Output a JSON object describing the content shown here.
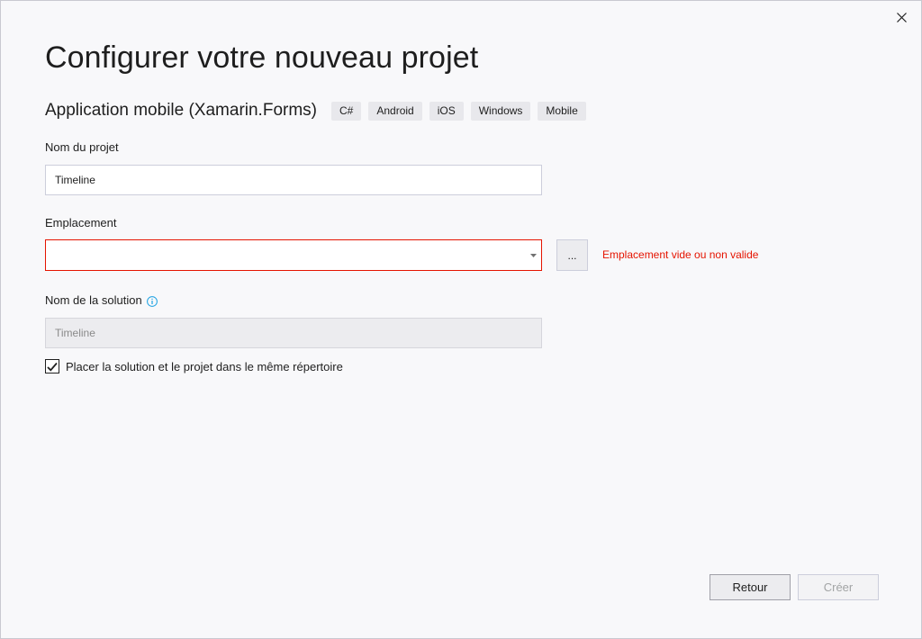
{
  "window": {
    "close_icon": "close-icon"
  },
  "header": {
    "title": "Configurer votre nouveau projet",
    "template_name": "Application mobile (Xamarin.Forms)",
    "tags": [
      "C#",
      "Android",
      "iOS",
      "Windows",
      "Mobile"
    ]
  },
  "project_name": {
    "label": "Nom du projet",
    "value": "Timeline"
  },
  "location": {
    "label": "Emplacement",
    "value": "",
    "browse_label": "...",
    "error": "Emplacement vide ou non valide",
    "error_color": "#e51400"
  },
  "solution_name": {
    "label": "Nom de la solution",
    "info_icon": "info-icon",
    "value": "Timeline",
    "disabled": true
  },
  "same_directory": {
    "label": "Placer la solution et le projet dans le même répertoire",
    "checked": true
  },
  "footer": {
    "back_label": "Retour",
    "create_label": "Créer",
    "create_disabled": true
  },
  "colors": {
    "background": "#f8f8fa",
    "error": "#e51400",
    "info": "#1ba1e2"
  }
}
